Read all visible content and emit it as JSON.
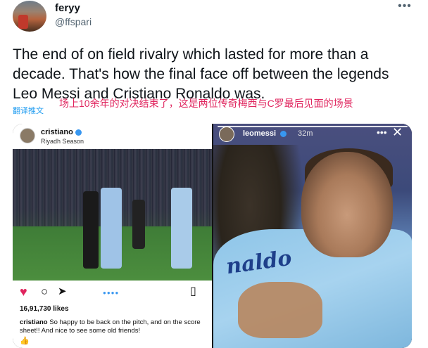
{
  "tweet": {
    "display_name": "feryy",
    "handle": "@ffspari",
    "more_icon": "more-horizontal-icon",
    "text": "The end of on field rivalry which lasted for more than a decade. That's how the final face off between the legends Leo Messi and Cristiano Ronaldo was.",
    "translate_label": "翻译推文",
    "overlay_caption": "场上10余年的对决结束了，这是两位传奇梅西与C罗最后见面的场景"
  },
  "left_post": {
    "username": "cristiano",
    "subtitle": "Riyadh Season",
    "likes": "16,91,730 likes",
    "caption_user": "cristiano",
    "caption_text": "So happy to be back on the pitch, and on the score sheet!! And nice to see some old friends!",
    "caption_emoji": "👍",
    "icons": {
      "like": "heart-icon",
      "comment": "comment-icon",
      "share": "share-icon",
      "save": "bookmark-icon"
    }
  },
  "right_story": {
    "username": "leomessi",
    "time": "32m",
    "jersey_text": "naldo",
    "icons": {
      "more": "more-horizontal-icon",
      "close": "close-icon"
    }
  },
  "colors": {
    "link_blue": "#1d9bf0",
    "caption_red": "#e0245e",
    "verified_blue": "#3897f0"
  }
}
